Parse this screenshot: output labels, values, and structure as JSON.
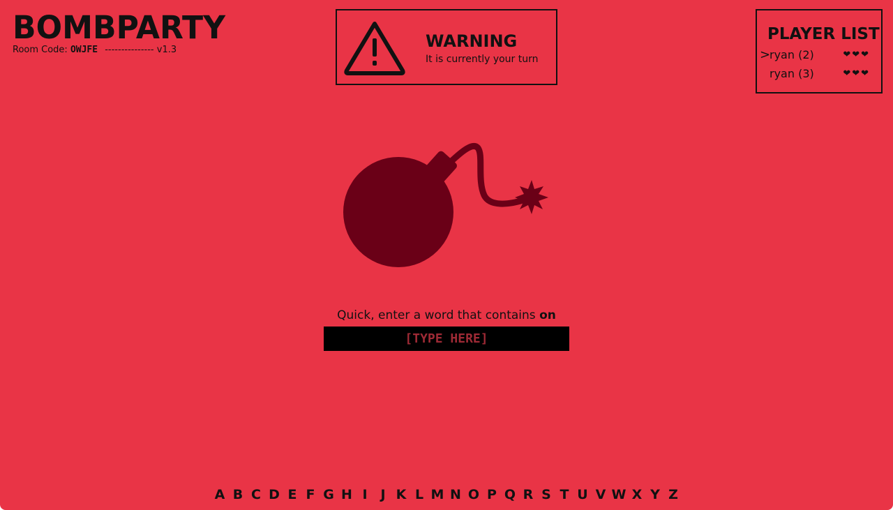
{
  "header": {
    "title": "BOMBPARTY",
    "room_label": "Room Code:",
    "room_code": "OWJFE",
    "divider": "---------------",
    "version": "v1.3"
  },
  "warning": {
    "icon": "warning-triangle-icon",
    "title": "WARNING",
    "message": "It is currently your turn"
  },
  "player_list": {
    "title": "PLAYER LIST",
    "players": [
      {
        "marker": ">",
        "name": "ryan (2)",
        "hearts": "❤❤❤"
      },
      {
        "marker": "",
        "name": "ryan (3)",
        "hearts": "❤❤❤"
      }
    ]
  },
  "game": {
    "bomb_icon": "bomb-icon",
    "prompt_prefix": "Quick, enter a word that contains",
    "syllable": "on",
    "input_placeholder": "[TYPE HERE]",
    "input_value": ""
  },
  "alphabet": [
    "A",
    "B",
    "C",
    "D",
    "E",
    "F",
    "G",
    "H",
    "I",
    "J",
    "K",
    "L",
    "M",
    "N",
    "O",
    "P",
    "Q",
    "R",
    "S",
    "T",
    "U",
    "V",
    "W",
    "X",
    "Y",
    "Z"
  ],
  "colors": {
    "background": "#e93446",
    "bomb": "#6a0017",
    "text": "#111111",
    "input_bg": "#000000",
    "input_text": "#9e2a35"
  }
}
